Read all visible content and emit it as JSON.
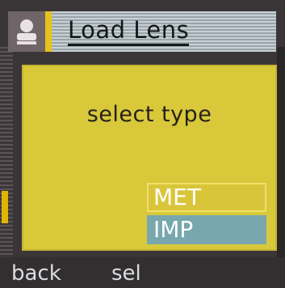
{
  "header": {
    "title": "Load Lens",
    "icon": "person-icon"
  },
  "dialog": {
    "prompt": "select type",
    "options": [
      {
        "label": "MET",
        "selected": true
      },
      {
        "label": "IMP",
        "selected": false
      }
    ]
  },
  "softkeys": {
    "left": "back",
    "center": "sel"
  },
  "colors": {
    "dialog_bg": "#d8c83a",
    "selected_bg": "#d9c53a",
    "option_bg": "#78a8ad",
    "header_bg": "#c6d0d6",
    "text_dark": "#15181a"
  }
}
